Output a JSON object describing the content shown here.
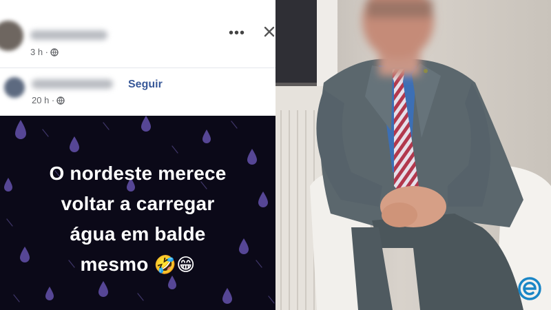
{
  "post": {
    "time_1": "3 h ·",
    "time_2": "20 h ·",
    "follow_label": "Seguir",
    "more_label": "•••",
    "text_line1": "O nordeste merece",
    "text_line2": "voltar a carregar",
    "text_line3": "água em balde",
    "text_line4": "mesmo",
    "emoji_1": "🤣",
    "emoji_2": "😁"
  },
  "colors": {
    "background": "#0b0918",
    "drops": "#5b4a9c",
    "link": "#385898",
    "watermark": "#1a86c6"
  },
  "icons": [
    "globe-icon",
    "more-icon",
    "close-icon",
    "rain-drop-icon",
    "watermark-logo"
  ]
}
